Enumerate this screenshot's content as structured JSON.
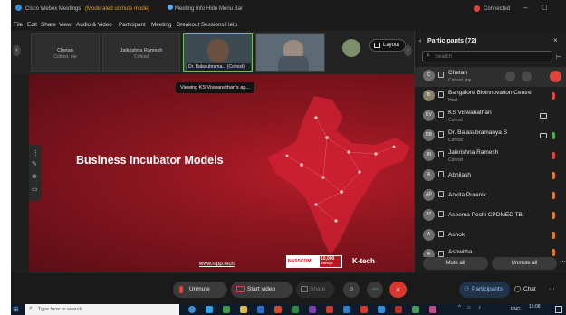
{
  "titlebar": {
    "app_title": "Cisco Webex Meetings",
    "meeting_info": "Meeting Info",
    "hide_menu": "Hide Menu Bar",
    "status": "Connected"
  },
  "menu": [
    "File",
    "Edit",
    "Share",
    "View",
    "Audio & Video",
    "Participant",
    "Meeting",
    "Breakout Sessions",
    "Help"
  ],
  "strip": {
    "tiles": [
      {
        "name": "Chetan",
        "role": "Cohost, me"
      },
      {
        "name": "Jaikrishna Ramesh",
        "role": "Cohost"
      },
      {
        "name": "Dr. Balasubrama... (Cohost)",
        "role": ""
      },
      {
        "name": "",
        "role": ""
      }
    ],
    "layout_label": "Layout"
  },
  "share": {
    "viewing_label": "Viewing KS Viswanathan's ap...",
    "slide_title": "Business Incubator Models",
    "slide_url": "www.nipp.tech",
    "nasscom_label": "NASSCOM",
    "nasscom_number": "10,000",
    "nasscom_sub": "startups",
    "ktech_label": "K-tech"
  },
  "panel": {
    "title": "Participants (72)",
    "search_placeholder": "Search",
    "participants": [
      {
        "initials": "C",
        "name": "Chetan",
        "role": "Cohost, me",
        "mic": "red"
      },
      {
        "initials": "B",
        "name": "Bangalore Bioinnovation Centre",
        "role": "Host",
        "mic": "red"
      },
      {
        "initials": "KV",
        "name": "KS Viswanathan",
        "role": "Cohost",
        "mic": "none"
      },
      {
        "initials": "DB",
        "name": "Dr. Balasubramanya S",
        "role": "Cohost",
        "mic": "green"
      },
      {
        "initials": "JR",
        "name": "Jaikrishna Ramesh",
        "role": "Cohost",
        "mic": "red"
      },
      {
        "initials": "A",
        "name": "Abhilash",
        "role": "",
        "mic": "orange"
      },
      {
        "initials": "AP",
        "name": "Ankita Puranik",
        "role": "",
        "mic": "orange"
      },
      {
        "initials": "AT",
        "name": "Aseema Pochi CPDMED TBI",
        "role": "",
        "mic": "orange"
      },
      {
        "initials": "A",
        "name": "Ashok",
        "role": "",
        "mic": "orange"
      },
      {
        "initials": "A",
        "name": "Ashwitha",
        "role": "",
        "mic": "orange"
      }
    ],
    "mute_all": "Mute all",
    "unmute_all": "Unmute all"
  },
  "controls": {
    "unmute": "Unmute",
    "start_video": "Start video",
    "share": "Share",
    "participants": "Participants",
    "chat": "Chat"
  },
  "taskbar": {
    "search_placeholder": "Type here to search",
    "lang": "ENG",
    "time": "15:08"
  },
  "colors": {
    "slide_red": "#9e1824",
    "end_red": "#d7372f",
    "participants_blue": "#5aa9f0"
  }
}
